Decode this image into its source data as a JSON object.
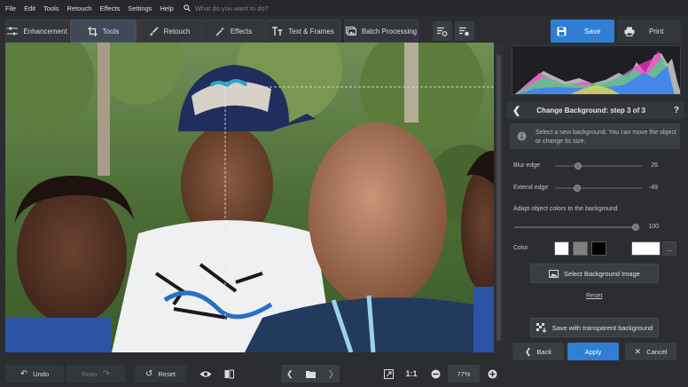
{
  "menu": {
    "items": [
      "File",
      "Edit",
      "Tools",
      "Retouch",
      "Effects",
      "Settings",
      "Help"
    ],
    "search_placeholder": "What do you want to do?"
  },
  "toolbar": {
    "enhancement": "Enhancement",
    "tools": "Tools",
    "retouch": "Retouch",
    "effects": "Effects",
    "text_frames": "Text & Frames",
    "batch": "Batch Processing",
    "save": "Save",
    "print": "Print"
  },
  "panel": {
    "step_title": "Change Background: step 3 of 3",
    "help": "?",
    "info_text": "Select a new background. You can move the object or change its size.",
    "blur_edge_label": "Blur edge",
    "blur_edge_value": "26",
    "blur_edge_level": 0.27,
    "extend_edge_label": "Extend edge",
    "extend_edge_value": "-49",
    "extend_edge_level": 0.26,
    "adapt_label": "Adapt object colors to the background",
    "adapt_value": "100",
    "adapt_level": 1.0,
    "color_label": "Color",
    "color_more": "...",
    "swatches": [
      "#ffffff",
      "#808080",
      "#000000"
    ],
    "custom_color": "#ffffff",
    "select_bg_image": "Select Background Image",
    "reset_link": "Reset",
    "save_transparent": "Save with transparent background",
    "back": "Back",
    "apply": "Apply",
    "cancel": "Cancel"
  },
  "bottom": {
    "undo": "Undo",
    "redo": "Redo",
    "reset": "Reset",
    "ratio": "1:1",
    "zoom": "77%"
  },
  "colors": {
    "accent": "#2e7fd3",
    "bg": "#2b2d31"
  }
}
